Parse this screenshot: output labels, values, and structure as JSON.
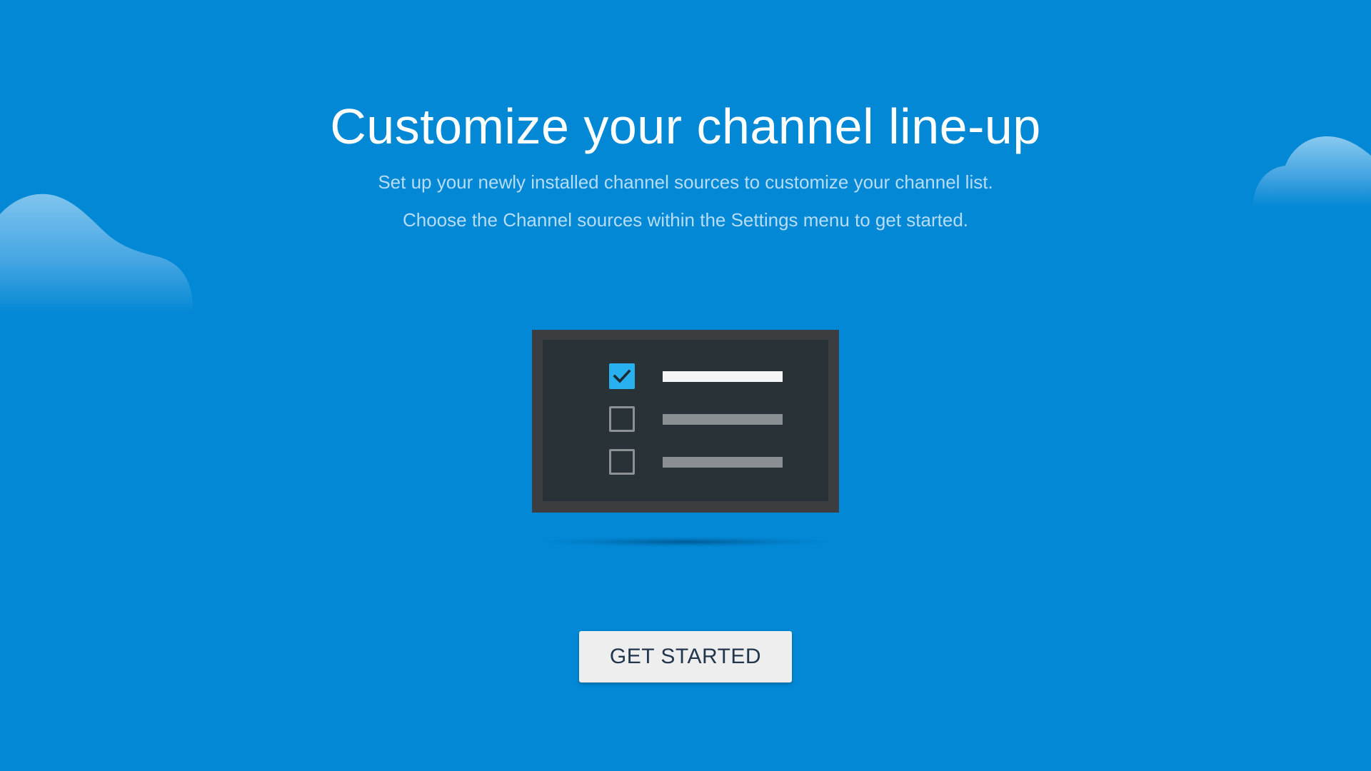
{
  "page": {
    "background_color": "#0288d4",
    "title": "Customize your channel line-up",
    "subtitle_line1": "Set up your newly installed channel sources to customize your channel list.",
    "subtitle_line2": "Choose the Channel sources within the Settings menu to get started."
  },
  "illustration": {
    "icon": "tv-checklist-icon",
    "items": [
      {
        "checked": true
      },
      {
        "checked": false
      },
      {
        "checked": false
      }
    ],
    "accent_color": "#29b0ef"
  },
  "actions": {
    "get_started_label": "GET STARTED"
  }
}
